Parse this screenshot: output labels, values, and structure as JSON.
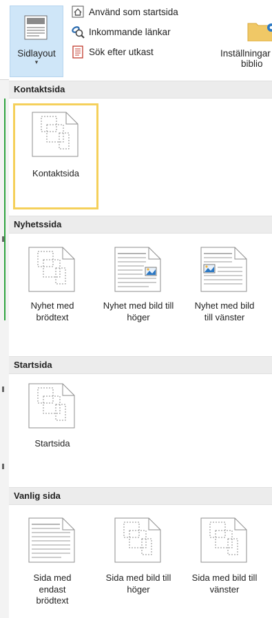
{
  "ribbon": {
    "sidlayout_label": "Sidlayout",
    "sidlayout_arrow": "▾",
    "commands": [
      {
        "label": "Använd som startsida",
        "icon": "home-page-icon"
      },
      {
        "label": "Inkommande länkar",
        "icon": "incoming-links-icon"
      },
      {
        "label": "Sök efter utkast",
        "icon": "find-drafts-icon"
      }
    ],
    "settings_line1": "Inställningar",
    "settings_line2": "biblio"
  },
  "sections": [
    {
      "title": "Kontaktsida",
      "items": [
        {
          "label": "Kontaktsida",
          "thumb": "generic",
          "selected": true
        }
      ]
    },
    {
      "title": "Nyhetssida",
      "items": [
        {
          "label": "Nyhet med brödtext",
          "thumb": "generic"
        },
        {
          "label": "Nyhet med bild till höger",
          "thumb": "image-right"
        },
        {
          "label": "Nyhet med bild till vänster",
          "thumb": "image-left"
        }
      ]
    },
    {
      "title": "Startsida",
      "items": [
        {
          "label": "Startsida",
          "thumb": "generic"
        }
      ]
    },
    {
      "title": "Vanlig sida",
      "items": [
        {
          "label": "Sida med endast brödtext",
          "thumb": "text-only"
        },
        {
          "label": "Sida med bild till höger",
          "thumb": "generic"
        },
        {
          "label": "Sida med bild till vänster",
          "thumb": "generic"
        }
      ]
    }
  ],
  "colors": {
    "selection": "#f5d05a",
    "ribbon_active": "#cfe6f8",
    "header_bg": "#ececec",
    "accent_green": "#2ea33d"
  }
}
